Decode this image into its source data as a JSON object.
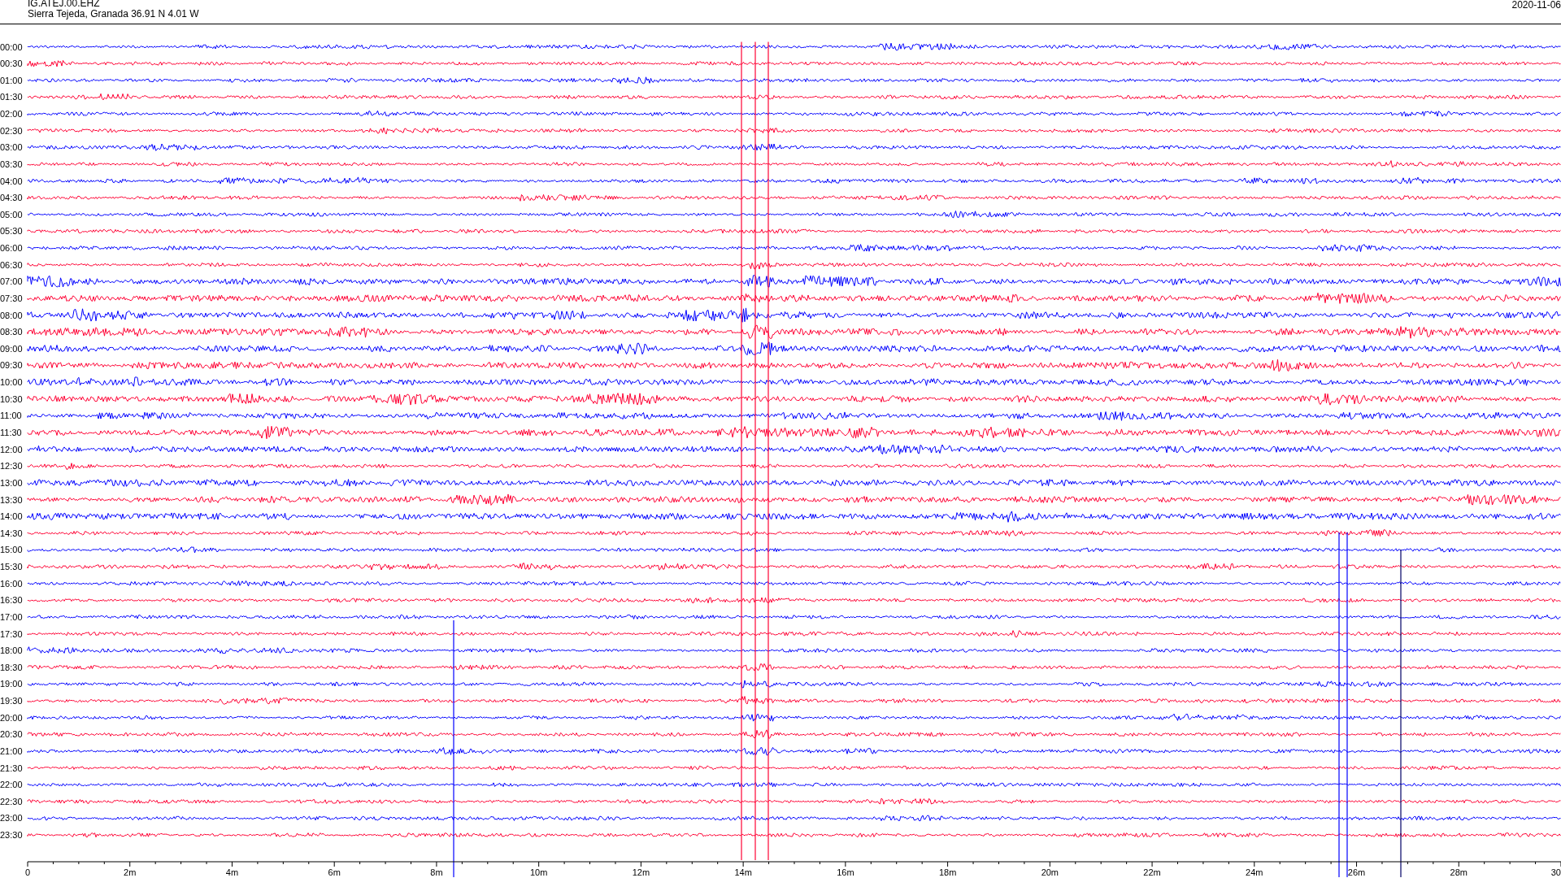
{
  "header": {
    "station_code": "IG.ATEJ.00.EHZ",
    "station_location": "Sierra Tejeda, Granada  36.91 N 4.01 W",
    "date": "2020-11-06"
  },
  "rows": [
    {
      "time": "00:00",
      "color": "#0000ff"
    },
    {
      "time": "00:30",
      "color": "#ff0033"
    },
    {
      "time": "01:00",
      "color": "#0000ff"
    },
    {
      "time": "01:30",
      "color": "#ff0033"
    },
    {
      "time": "02:00",
      "color": "#0000ff"
    },
    {
      "time": "02:30",
      "color": "#ff0033"
    },
    {
      "time": "03:00",
      "color": "#0000ff"
    },
    {
      "time": "03:30",
      "color": "#ff0033"
    },
    {
      "time": "04:00",
      "color": "#0000ff"
    },
    {
      "time": "04:30",
      "color": "#ff0033"
    },
    {
      "time": "05:00",
      "color": "#0000ff"
    },
    {
      "time": "05:30",
      "color": "#ff0033"
    },
    {
      "time": "06:00",
      "color": "#0000ff"
    },
    {
      "time": "06:30",
      "color": "#ff0033"
    },
    {
      "time": "07:00",
      "color": "#0000ff"
    },
    {
      "time": "07:30",
      "color": "#ff0033"
    },
    {
      "time": "08:00",
      "color": "#0000ff"
    },
    {
      "time": "08:30",
      "color": "#ff0033"
    },
    {
      "time": "09:00",
      "color": "#0000ff"
    },
    {
      "time": "09:30",
      "color": "#ff0033"
    },
    {
      "time": "10:00",
      "color": "#0000ff"
    },
    {
      "time": "10:30",
      "color": "#ff0033"
    },
    {
      "time": "11:00",
      "color": "#0000ff"
    },
    {
      "time": "11:30",
      "color": "#ff0033"
    },
    {
      "time": "12:00",
      "color": "#0000ff"
    },
    {
      "time": "12:30",
      "color": "#ff0033"
    },
    {
      "time": "13:00",
      "color": "#0000ff"
    },
    {
      "time": "13:30",
      "color": "#ff0033"
    },
    {
      "time": "14:00",
      "color": "#0000ff"
    },
    {
      "time": "14:30",
      "color": "#ff0033"
    },
    {
      "time": "15:00",
      "color": "#0000ff"
    },
    {
      "time": "15:30",
      "color": "#ff0033"
    },
    {
      "time": "16:00",
      "color": "#0000ff"
    },
    {
      "time": "16:30",
      "color": "#ff0033"
    },
    {
      "time": "17:00",
      "color": "#0000ff"
    },
    {
      "time": "17:30",
      "color": "#ff0033"
    },
    {
      "time": "18:00",
      "color": "#0000ff"
    },
    {
      "time": "18:30",
      "color": "#ff0033"
    },
    {
      "time": "19:00",
      "color": "#0000ff"
    },
    {
      "time": "19:30",
      "color": "#ff0033"
    },
    {
      "time": "20:00",
      "color": "#0000ff"
    },
    {
      "time": "20:30",
      "color": "#ff0033"
    },
    {
      "time": "21:00",
      "color": "#0000ff"
    },
    {
      "time": "21:30",
      "color": "#ff0033"
    },
    {
      "time": "22:00",
      "color": "#0000ff"
    },
    {
      "time": "22:30",
      "color": "#ff0033"
    },
    {
      "time": "23:00",
      "color": "#0000ff"
    },
    {
      "time": "23:30",
      "color": "#ff0033"
    }
  ],
  "x_axis": {
    "ticks": [
      "0",
      "2m",
      "4m",
      "6m",
      "8m",
      "10m",
      "12m",
      "14m",
      "16m",
      "18m",
      "20m",
      "22m",
      "24m",
      "26m",
      "28m",
      "30"
    ]
  }
}
